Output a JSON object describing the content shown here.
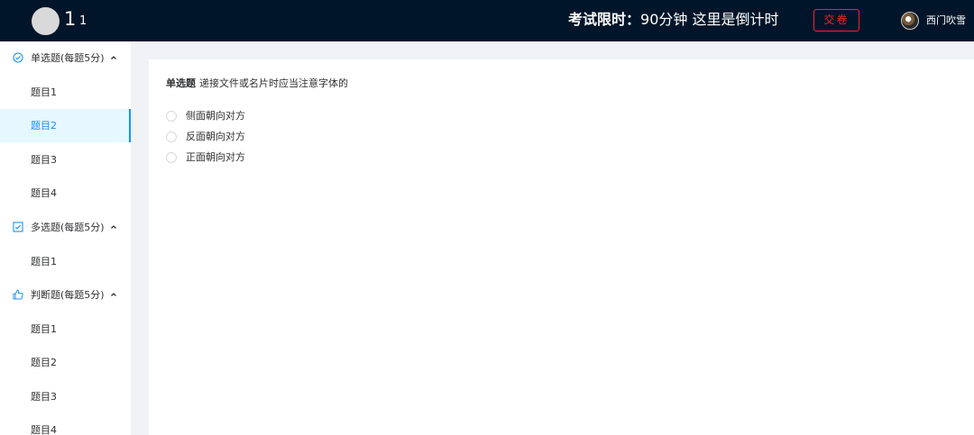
{
  "header": {
    "logo_title": "1",
    "logo_subtitle": "1",
    "timer_label": "考试限时：",
    "timer_value": "90分钟 这里是倒计时",
    "submit_label": "交卷",
    "user_name": "西门吹雪"
  },
  "sidebar": {
    "groups": [
      {
        "icon": "check-circle-icon",
        "title": "单选题(每题5分)",
        "items": [
          "题目1",
          "题目2",
          "题目3",
          "题目4"
        ],
        "active_index": 1
      },
      {
        "icon": "checkbox-icon",
        "title": "多选题(每题5分)",
        "items": [
          "题目1"
        ]
      },
      {
        "icon": "thumbs-up-icon",
        "title": "判断题(每题5分)",
        "items": [
          "题目1",
          "题目2",
          "题目3",
          "题目4"
        ]
      }
    ]
  },
  "main": {
    "question_type": "单选题",
    "question_text": "递接文件或名片时应当注意字体的",
    "options": [
      "侧面朝向对方",
      "反面朝向对方",
      "正面朝向对方"
    ]
  },
  "colors": {
    "header_bg": "#001529",
    "accent": "#1890ff",
    "submit_red": "#f5222d",
    "page_bg": "#f0f2f5"
  }
}
